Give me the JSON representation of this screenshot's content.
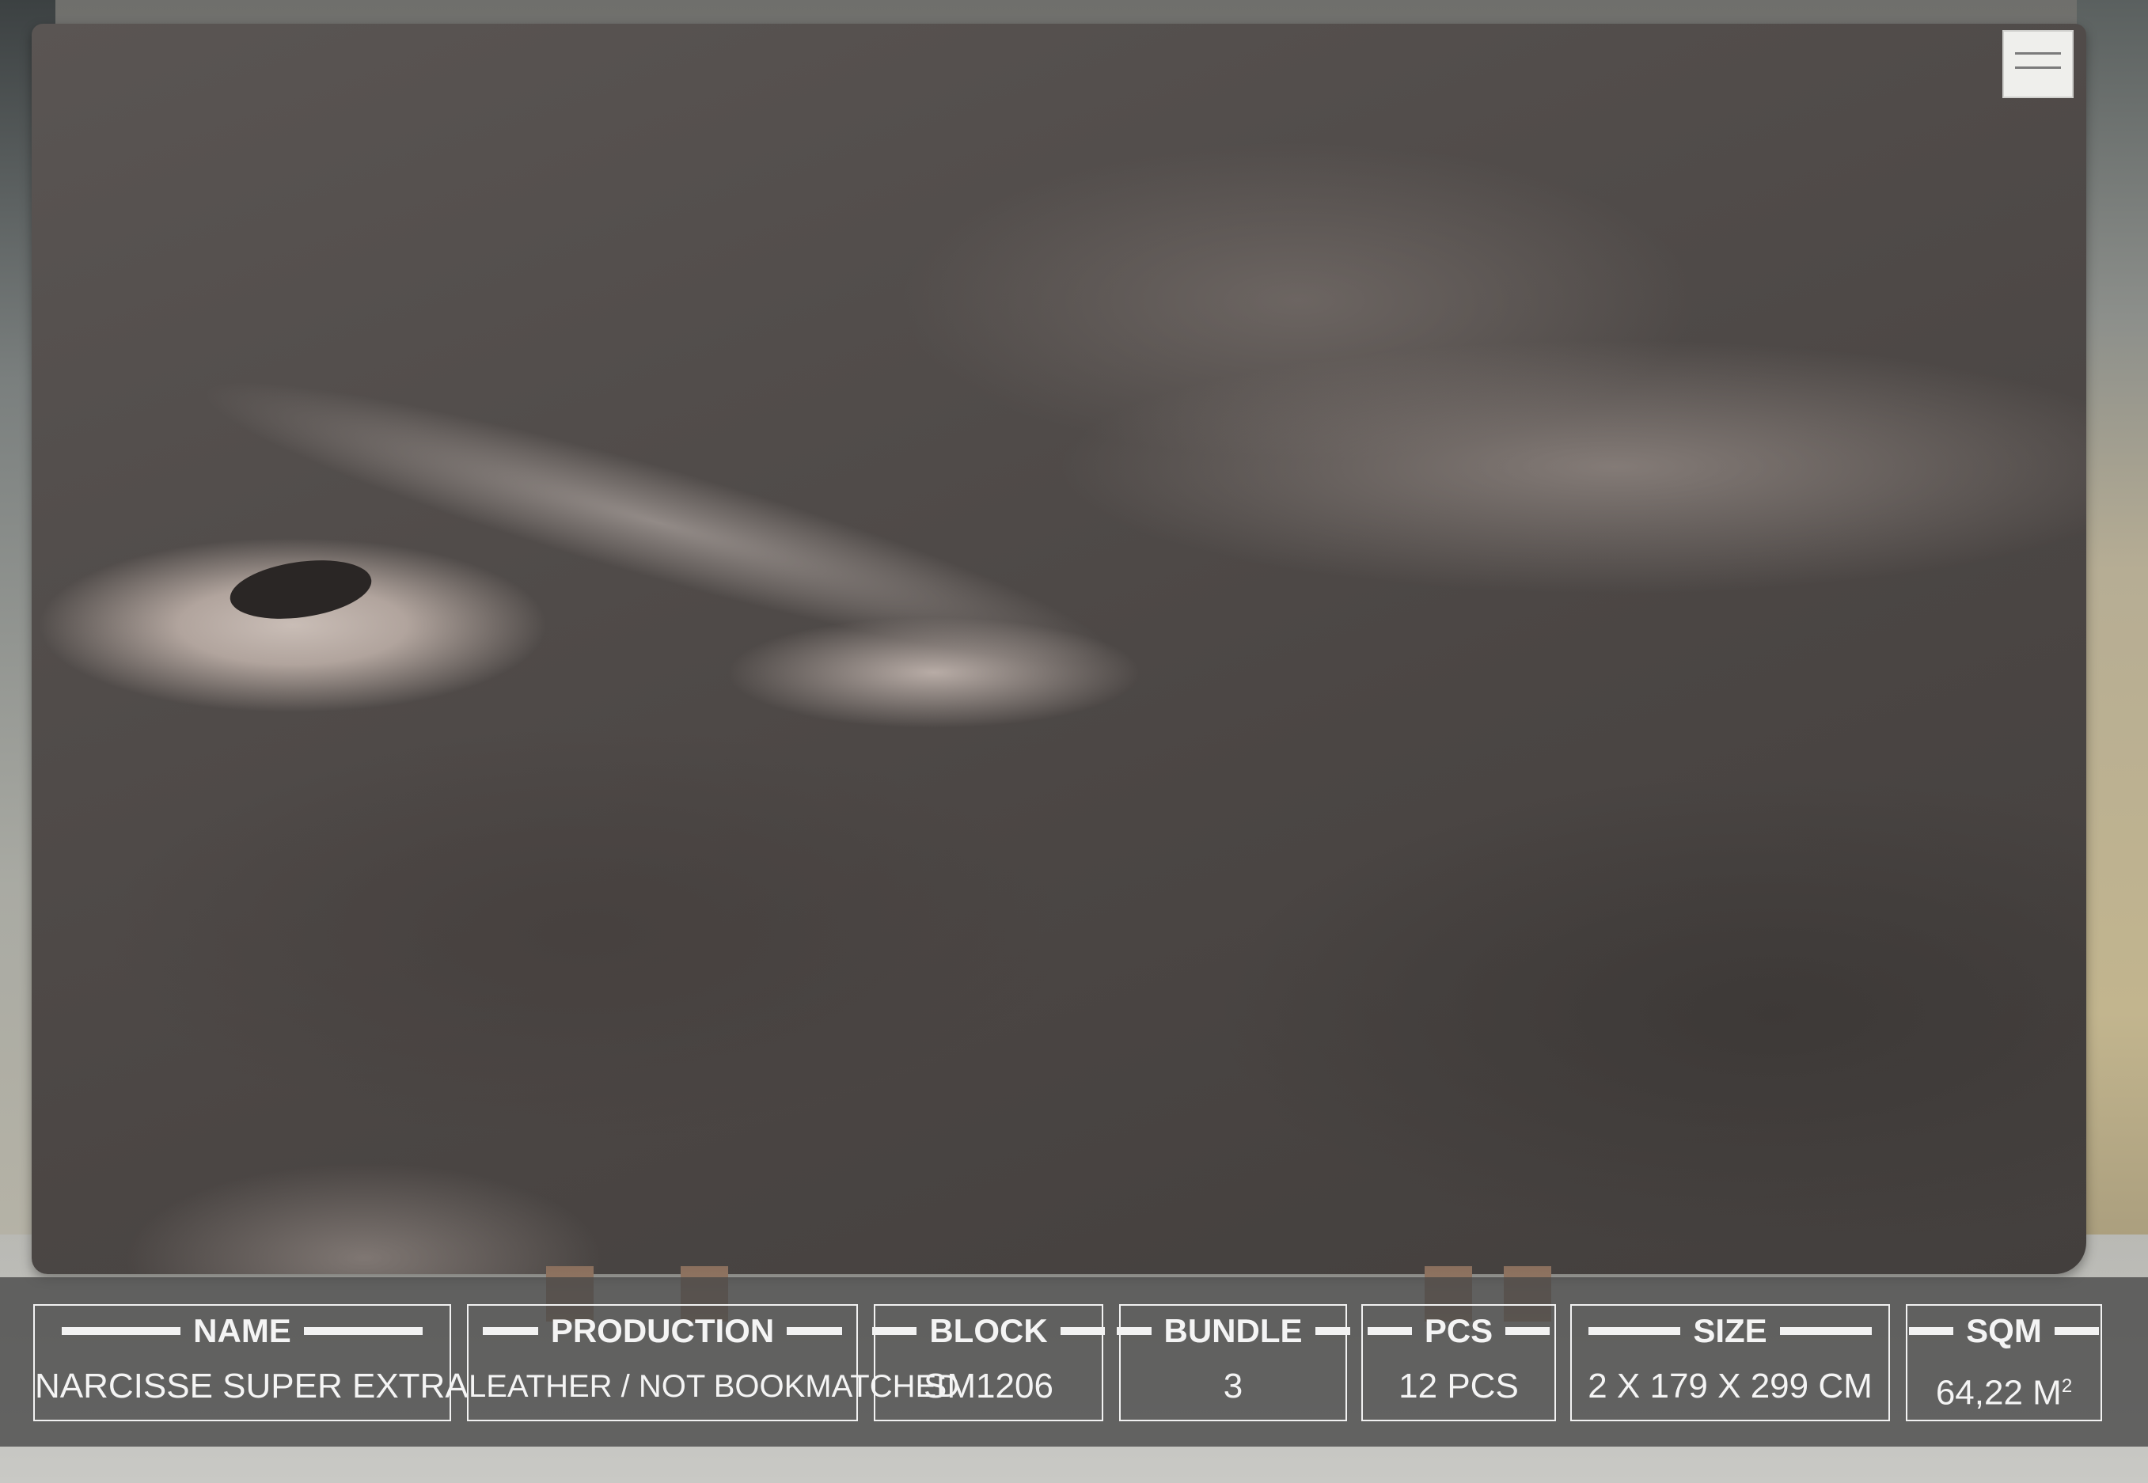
{
  "slab_info": [
    {
      "label": "NAME",
      "value": "NARCISSE SUPER EXTRA"
    },
    {
      "label": "PRODUCTION",
      "value": "LEATHER /   NOT BOOKMATCHED"
    },
    {
      "label": "BLOCK",
      "value": "SM1206"
    },
    {
      "label": "BUNDLE",
      "value": "3"
    },
    {
      "label": "PCS",
      "value": "12 PCS"
    },
    {
      "label": "SIZE",
      "value": "2 X 179 X 299 CM"
    },
    {
      "label": "SQM",
      "value": "64,22 M",
      "superscript": "2"
    }
  ],
  "colors": {
    "label_bar": "#484848",
    "label_text": "#f4f4f4",
    "slab": "#4f4a48"
  }
}
